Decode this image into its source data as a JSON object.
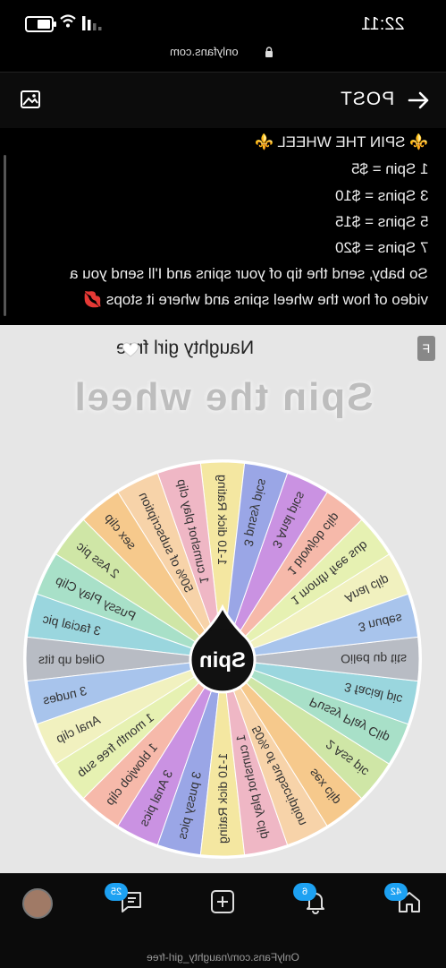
{
  "status_bar": {
    "time": "22:11"
  },
  "browser": {
    "url": "onlyfans.com"
  },
  "top_nav": {
    "post_label": "POST"
  },
  "caption": {
    "lines": [
      "⚜️ SPIN THE WHEEL ⚜️",
      "1 Spin = $5",
      "3 Spins = $10",
      "5 Spins = $15",
      "7 Spins = $20",
      "So baby, send the tip of your spins and I'll send you a",
      "video of how the wheel spins and where it stops 💋"
    ]
  },
  "wheel_card": {
    "title": "Naughty girl free",
    "badge": "F",
    "heading": "Spin the wheel",
    "center_label": "Spin",
    "slices": [
      {
        "label": "1-10 dick Rating",
        "color": "#f4e7a1"
      },
      {
        "label": "1 cumshot play clip",
        "color": "#efb7c5"
      },
      {
        "label": "50% of subscription",
        "color": "#f7d3a9"
      },
      {
        "label": "sex clip",
        "color": "#f6c98c"
      },
      {
        "label": "2 Ass pic",
        "color": "#cfe6a6"
      },
      {
        "label": "Pussy Play Clip",
        "color": "#a8e0c8"
      },
      {
        "label": "3 facial pic",
        "color": "#9ad6de"
      },
      {
        "label": "Oiled up tits",
        "color": "#b8bcc4"
      },
      {
        "label": "3 nudes",
        "color": "#a8c4ec"
      },
      {
        "label": "Anal clip",
        "color": "#f1f1bf"
      },
      {
        "label": "1 month free sub",
        "color": "#e6f1b2"
      },
      {
        "label": "1 blowjob clip",
        "color": "#f6b9aa"
      },
      {
        "label": "3 Anal pics",
        "color": "#ca92e2"
      },
      {
        "label": "3 pussy pics",
        "color": "#9aa6e6"
      },
      {
        "label": "1-10 dick Rating",
        "color": "#f4e7a1"
      },
      {
        "label": "1 cumshot play clip",
        "color": "#efb7c5"
      },
      {
        "label": "50% of subscription",
        "color": "#f7d3a9"
      },
      {
        "label": "sex clip",
        "color": "#f6c98c"
      },
      {
        "label": "2 Ass pic",
        "color": "#cfe6a6"
      },
      {
        "label": "Pussy Play Clip",
        "color": "#a8e0c8"
      },
      {
        "label": "3 facial pic",
        "color": "#9ad6de"
      },
      {
        "label": "Oiled up tits",
        "color": "#b8bcc4"
      },
      {
        "label": "3 nudes",
        "color": "#a8c4ec"
      },
      {
        "label": "Anal clip",
        "color": "#f1f1bf"
      },
      {
        "label": "1 month free sub",
        "color": "#e6f1b2"
      },
      {
        "label": "1 blowjob clip",
        "color": "#f6b9aa"
      },
      {
        "label": "3 Anal pics",
        "color": "#ca92e2"
      },
      {
        "label": "3 pussy pics",
        "color": "#9aa6e6"
      }
    ]
  },
  "bottom_nav": {
    "home_badge": "42",
    "notifications_badge": "6",
    "messages_badge": "25"
  },
  "footer": {
    "url": "OnlyFans.com/naughty_girl-free"
  }
}
